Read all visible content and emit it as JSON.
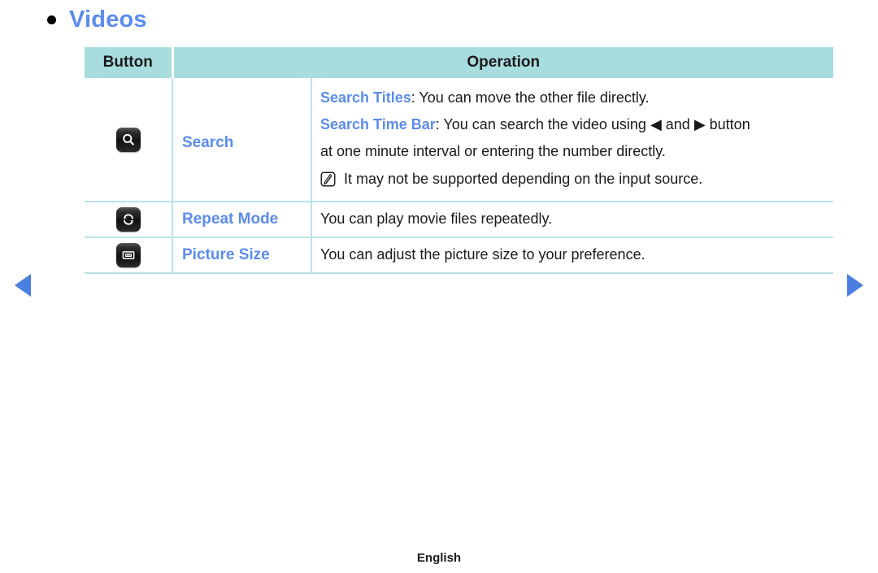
{
  "heading": {
    "bullet": "bullet-dot",
    "title": "Videos"
  },
  "table": {
    "headers": {
      "button": "Button",
      "operation": "Operation"
    },
    "rows": [
      {
        "icon": "search-icon",
        "label": "Search",
        "lines": [
          {
            "term": "Search Titles",
            "rest": ": You can move the other file directly."
          },
          {
            "term": "Search Time Bar",
            "rest": ": You can search the video using ◀ and ▶ button"
          },
          {
            "term": "",
            "rest": "at one minute interval or entering the number directly."
          }
        ],
        "note": {
          "icon": "note-icon",
          "text": "It may not be supported depending on the input source."
        }
      },
      {
        "icon": "repeat-icon",
        "label": "Repeat Mode",
        "text": "You can play movie files repeatedly."
      },
      {
        "icon": "picture-size-icon",
        "label": "Picture Size",
        "text": "You can adjust the picture size to your preference."
      }
    ]
  },
  "navigation": {
    "prev": "previous-page-arrow",
    "next": "next-page-arrow"
  },
  "footer": {
    "language": "English"
  },
  "colors": {
    "accent_blue": "#5b8ceb",
    "header_teal": "#a8dde0",
    "border_teal": "#b9e3e6",
    "arrow_blue": "#4a7fe0",
    "text_black": "#1a1a1a"
  }
}
